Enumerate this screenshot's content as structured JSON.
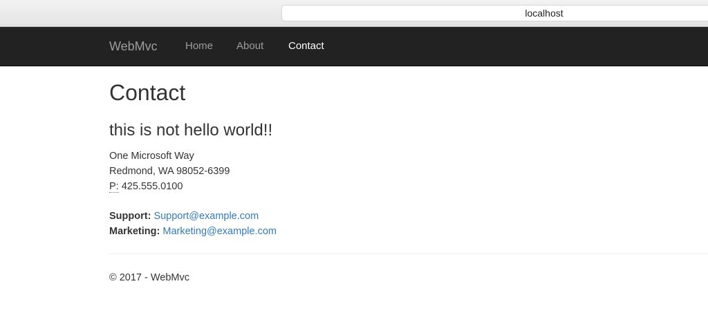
{
  "browser": {
    "address": "localhost"
  },
  "navbar": {
    "brand": "WebMvc",
    "links": [
      {
        "label": "Home"
      },
      {
        "label": "About"
      },
      {
        "label": "Contact"
      }
    ],
    "active_link": "Contact"
  },
  "main": {
    "title": "Contact",
    "subtitle": "this is not hello world!!",
    "address": {
      "line1": "One Microsoft Way",
      "line2": "Redmond, WA 98052-6399",
      "phone_label": "P:",
      "phone": "425.555.0100"
    },
    "contacts": [
      {
        "label": "Support:",
        "email": "Support@example.com"
      },
      {
        "label": "Marketing:",
        "email": "Marketing@example.com"
      }
    ]
  },
  "footer": {
    "text": "© 2017 - WebMvc"
  },
  "colors": {
    "navbar_bg": "#222222",
    "nav_text": "#9d9d9d",
    "nav_active": "#ffffff",
    "link": "#337ab7",
    "text": "#333333"
  }
}
